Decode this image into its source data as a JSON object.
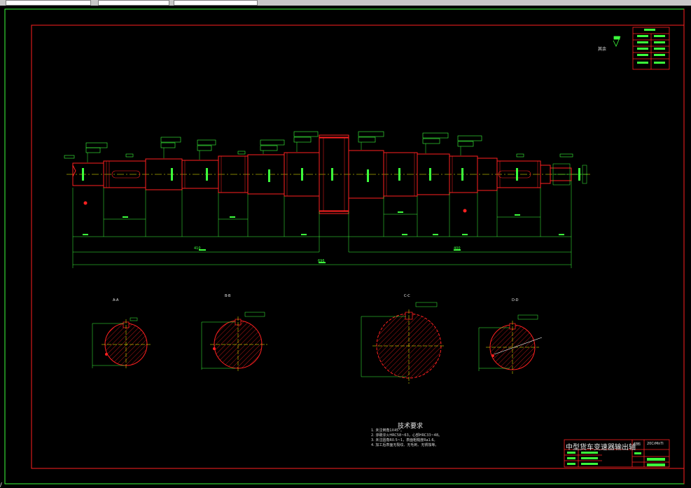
{
  "app": {
    "toolbar_fields": 3
  },
  "drawing": {
    "sheet_title": "中型货车变速器输出轴",
    "roughness_note": "其余",
    "section_labels": [
      "A-A",
      "B-B",
      "C-C",
      "D-D"
    ],
    "technical_requirements": {
      "heading": "技术要求",
      "items": [
        "1. 未注倒角1X45°。",
        "2. 渗碳淬火HRC58~63，心部HRC33~48。",
        "3. 未注圆角R0.5~1，表面粗糙度Ra1.6。",
        "4. 加工后表面无裂纹、无毛刺、无锈蚀等。"
      ]
    },
    "title_block": {
      "name": "中型货车变速器输出轴",
      "material_label": "材料",
      "material": "20CrMnTi"
    },
    "overall_dims": {
      "left_total": "410",
      "right_total": "400",
      "grand_total": "696"
    },
    "colors": {
      "frame": "#3cff3c",
      "part": "#ff2020",
      "hatch": "#ff2020",
      "center": "#ffff00",
      "dim": "#3cff3c",
      "text": "#e8e8e8"
    }
  }
}
